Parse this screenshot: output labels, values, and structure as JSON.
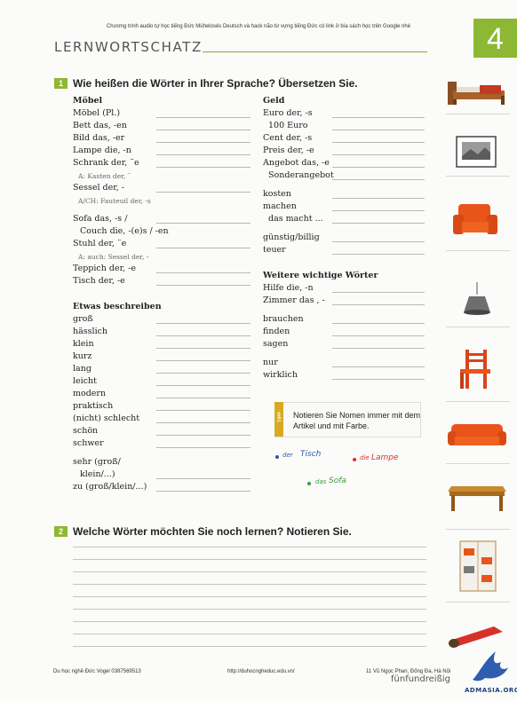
{
  "top_note": "Chương trình audio tự học tiếng Đức Mühelosés Deutsch và hack não từ vựng tiếng Đức có link ở bìa sách học trên Google nhé",
  "title": "LERNWORTSCHATZ",
  "chapter_number": "4",
  "task1": {
    "number": "1",
    "text": "Wie heißen die Wörter in Ihrer Sprache? Übersetzen Sie."
  },
  "moebel": {
    "heading": "Möbel",
    "items": [
      "Möbel (Pl.)",
      "Bett das, -en",
      "Bild das, -er",
      "Lampe die, -n",
      "Schrank der, ¨e"
    ],
    "note1": "A: Kasten der, ¨",
    "sessel": "Sessel der, -",
    "note2": "A/CH: Fauteuil der, -s",
    "sofa1": "Sofa das, -s /",
    "sofa2": "Couch die, -(e)s / -en",
    "stuhl": "Stuhl der, ¨e",
    "note3": "A: auch: Sessel der, -",
    "teppich": "Teppich der, -e",
    "tisch": "Tisch der, -e"
  },
  "beschreiben": {
    "heading": "Etwas beschreiben",
    "items": [
      "groß",
      "hässlich",
      "klein",
      "kurz",
      "lang",
      "leicht",
      "modern",
      "praktisch",
      "(nicht) schlecht",
      "schön",
      "schwer"
    ],
    "sehr1": "sehr (groß/",
    "sehr2": "klein/...)",
    "zu": "zu (groß/klein/...)"
  },
  "geld": {
    "heading": "Geld",
    "euro": "Euro der, -s",
    "euro_ex": "100 Euro",
    "cent": "Cent der, -s",
    "preis": "Preis der, -e",
    "angebot": "Angebot das, -e",
    "sonderangebot": "Sonderangebot",
    "kosten": "kosten",
    "machen": "machen",
    "dasmacht": "das macht ...",
    "guenstig": "günstig/billig",
    "teuer": "teuer"
  },
  "weitere": {
    "heading": "Weitere wichtige Wörter",
    "hilfe": "Hilfe die, -n",
    "zimmer": "Zimmer das , -",
    "brauchen": "brauchen",
    "finden": "finden",
    "sagen": "sagen",
    "nur": "nur",
    "wirklich": "wirklich"
  },
  "tip": {
    "label": "TIPP",
    "text": "Notieren Sie Nomen immer mit dem Artikel und mit Farbe.",
    "der": "der",
    "tisch": "Tisch",
    "die": "die",
    "lampe": "Lampe",
    "das": "das",
    "sofa": "Sofa",
    "colors": {
      "masculine": "#2e57a8",
      "feminine": "#d6322a",
      "neuter": "#3b9a3b"
    }
  },
  "task2": {
    "number": "2",
    "text": "Welche Wörter möchten Sie noch lernen? Notieren Sie."
  },
  "footer": {
    "left": "Du học nghề Đức Vogel 0387569513",
    "mid": "http://duhocngheduc.edu.vn/",
    "right": "11 Vũ Ngọc Phan, Đống Đa, Hà Nội",
    "page": "fünfundreißig",
    "logo": "ADMASIA.ORG"
  },
  "accent_color": "#8cb833"
}
